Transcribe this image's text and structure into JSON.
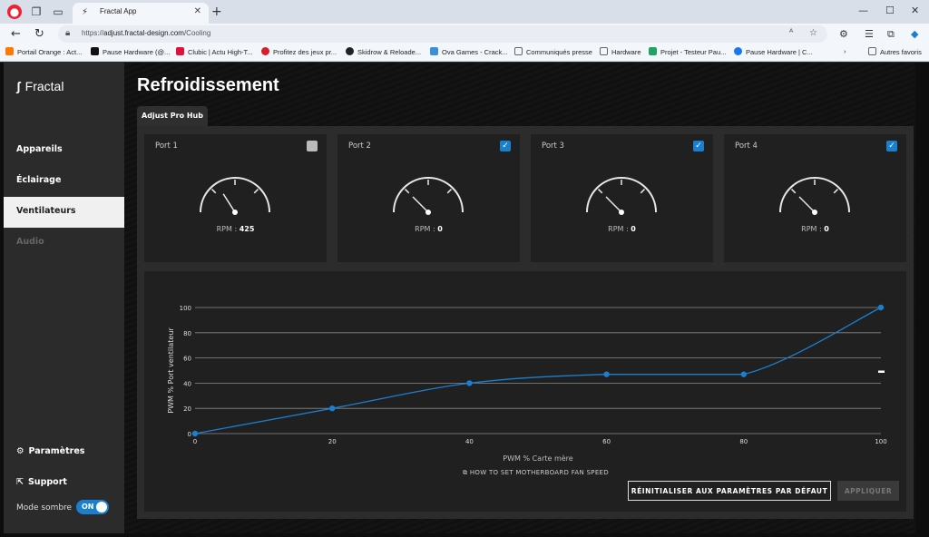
{
  "browser": {
    "tab_title": "Fractal App",
    "url_prefix": "https://",
    "url_host": "adjust.fractal-design.com",
    "url_path": "/Cooling",
    "bookmarks": [
      {
        "label": "Portail Orange : Act...",
        "color": "#ff7900"
      },
      {
        "label": "Pause Hardware (@...",
        "color": "#111111"
      },
      {
        "label": "Clubic | Actu High-T...",
        "color": "#e0123c"
      },
      {
        "label": "Profitez des jeux pr...",
        "color": "#d4202a"
      },
      {
        "label": "Skidrow & Reloade...",
        "color": "#222222"
      },
      {
        "label": "Ova Games - Crack...",
        "color": "#3a8fd8"
      },
      {
        "label": "Communiqués presse",
        "color": "#888888"
      },
      {
        "label": "Hardware",
        "color": "#888888"
      },
      {
        "label": "Projet - Testeur Pau...",
        "color": "#1fa463"
      },
      {
        "label": "Pause Hardware | C...",
        "color": "#1877f2"
      }
    ],
    "other_favorites": "Autres favoris"
  },
  "sidebar": {
    "brand": "Fractal",
    "items": [
      {
        "label": "Appareils"
      },
      {
        "label": "Éclairage"
      },
      {
        "label": "Ventilateurs"
      },
      {
        "label": "Audio"
      }
    ],
    "settings": "Paramètres",
    "support": "Support",
    "mode_label": "Mode sombre",
    "toggle": "ON"
  },
  "main": {
    "title": "Refroidissement",
    "hub_tab": "Adjust Pro Hub",
    "rpm_label": "RPM : ",
    "ports": [
      {
        "name": "Port 1",
        "checked": false,
        "rpm": "425",
        "needle": 0.32
      },
      {
        "name": "Port 2",
        "checked": true,
        "rpm": "0",
        "needle": 0.25
      },
      {
        "name": "Port 3",
        "checked": true,
        "rpm": "0",
        "needle": 0.25
      },
      {
        "name": "Port 4",
        "checked": true,
        "rpm": "0",
        "needle": 0.25
      }
    ],
    "help_link": "HOW TO SET MOTHERBOARD FAN SPEED",
    "reset_button": "RÉINITIALISER AUX PARAMÈTRES PAR DÉFAUT",
    "apply_button": "APPLIQUER"
  },
  "chart_data": {
    "type": "line",
    "xlabel": "PWM % Carte mère",
    "ylabel": "PWM % Port ventilateur",
    "xlim": [
      0,
      100
    ],
    "ylim": [
      0,
      100
    ],
    "x_ticks": [
      0,
      20,
      40,
      60,
      80,
      100
    ],
    "y_ticks": [
      0,
      20,
      40,
      60,
      80,
      100
    ],
    "grid": true,
    "color": "#1b7fd0",
    "points": [
      [
        0,
        0
      ],
      [
        20,
        20
      ],
      [
        40,
        40
      ],
      [
        60,
        47
      ],
      [
        80,
        47
      ],
      [
        100,
        100
      ]
    ]
  }
}
